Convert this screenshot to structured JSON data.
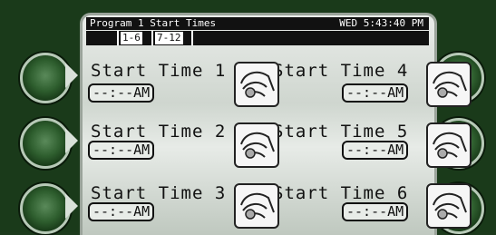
{
  "screen": {
    "title": "Program 1 Start Times",
    "clock": "WED 5:43:40 PM",
    "tabs": [
      "1-6",
      "7-12"
    ]
  },
  "start_times": [
    {
      "label": "Start Time 1",
      "value": "--:--AM"
    },
    {
      "label": "Start Time 2",
      "value": "--:--AM"
    },
    {
      "label": "Start Time 3",
      "value": "--:--AM"
    },
    {
      "label": "Start Time 4",
      "value": "--:--AM"
    },
    {
      "label": "Start Time 5",
      "value": "--:--AM"
    },
    {
      "label": "Start Time 6",
      "value": "--:--AM"
    }
  ],
  "icons": {
    "touch": "finger-tap-icon",
    "hardware_button": "round-select-button"
  },
  "colors": {
    "bezel": "#1a3a1a",
    "lcd_bg": "#dde3dd",
    "lcd_text": "#111111"
  }
}
